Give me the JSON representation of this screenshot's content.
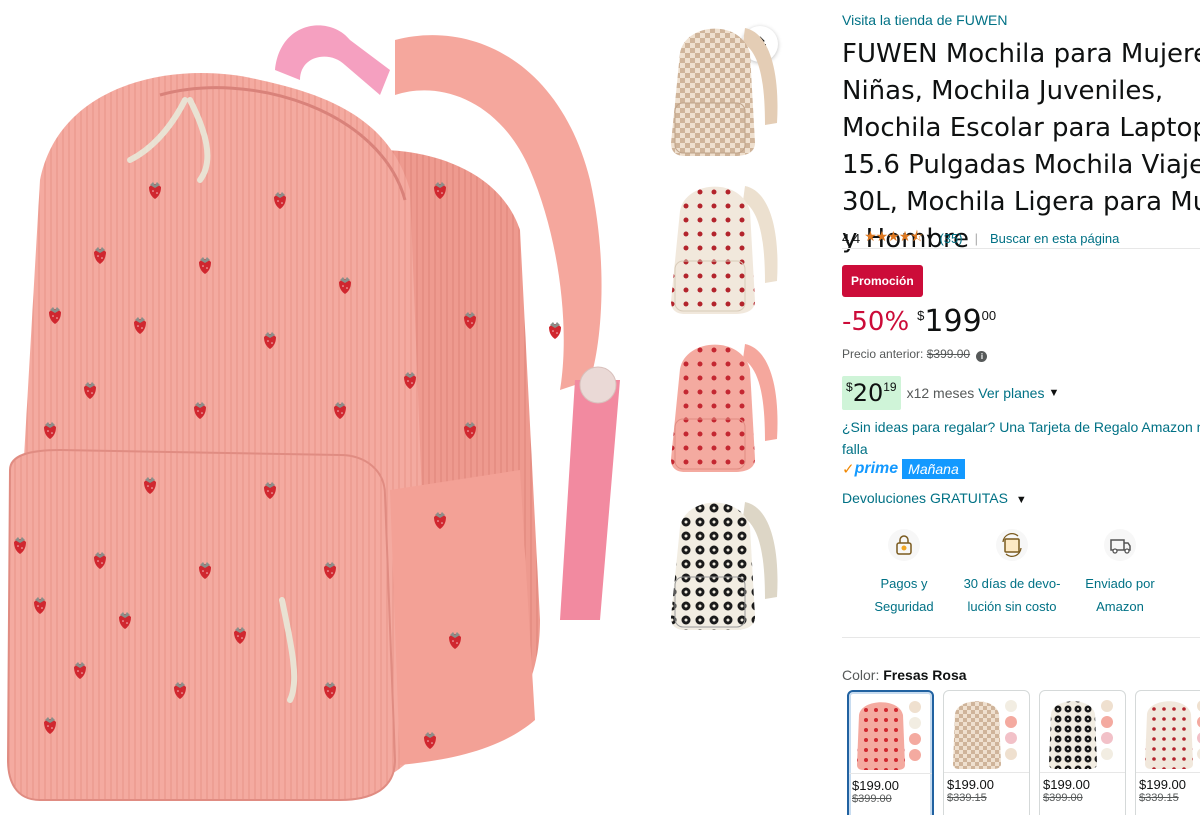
{
  "store": {
    "link": "Visita la tienda de FUWEN"
  },
  "product": {
    "title": "FUWEN Mochila para Mujeres Niñas, Mochila Juveniles, Mochila Escolar para Laptop 15.6 Pulgadas Mochila Viaje 30L, Mochila Ligera para Mujere y Hombre",
    "rating": "4.4",
    "stars": "★★★★⯪",
    "rating_count": "(35)",
    "search_page": "Buscar en esta página"
  },
  "pricing": {
    "promo_badge": "Promoción",
    "discount": "-50%",
    "currency": "$",
    "price_whole": "199",
    "price_fraction": "00",
    "previous_label": "Precio anterior:",
    "previous_price": "$399.00",
    "installment_currency": "$",
    "installment_whole": "20",
    "installment_fraction": "19",
    "installment_months": "x12 meses",
    "installment_plans": "Ver planes"
  },
  "gift": {
    "text": "¿Sin ideas para regalar? Una Tarjeta de Regalo Amazon no falla"
  },
  "prime": {
    "check": "✓",
    "word": "prime",
    "delivery": "Mañana"
  },
  "returns": {
    "label": "Devoluciones GRATUITAS"
  },
  "features": [
    {
      "line1": "Pagos y",
      "line2": "Seguridad",
      "icon": "secure-payment-icon"
    },
    {
      "line1": "30 días de devo-",
      "line2": "lución sin costo",
      "icon": "return-box-icon"
    },
    {
      "line1": "Enviado por",
      "line2": "Amazon",
      "icon": "delivery-truck-icon"
    }
  ],
  "color": {
    "label": "Color:",
    "value": "Fresas Rosa",
    "options": [
      {
        "price": "$199.00",
        "old_price": "$399.00",
        "pattern": "strawberry-pink"
      },
      {
        "price": "$199.00",
        "old_price": "$339.15",
        "pattern": "checker-beige"
      },
      {
        "price": "$199.00",
        "old_price": "$399.00",
        "pattern": "flower-black"
      },
      {
        "price": "$199.00",
        "old_price": "$339.15",
        "pattern": "dots-cream"
      }
    ]
  },
  "thumbnails": [
    {
      "pattern": "checker-beige"
    },
    {
      "pattern": "dots-cream"
    },
    {
      "pattern": "dots-pink"
    },
    {
      "pattern": "flower-black"
    }
  ],
  "colors": {
    "link": "#007185",
    "promo": "#cc0c39",
    "star": "#de7921",
    "prime": "#1399ff",
    "backpack_pink": "#f2a49a",
    "strawberry_red": "#d0272f"
  }
}
